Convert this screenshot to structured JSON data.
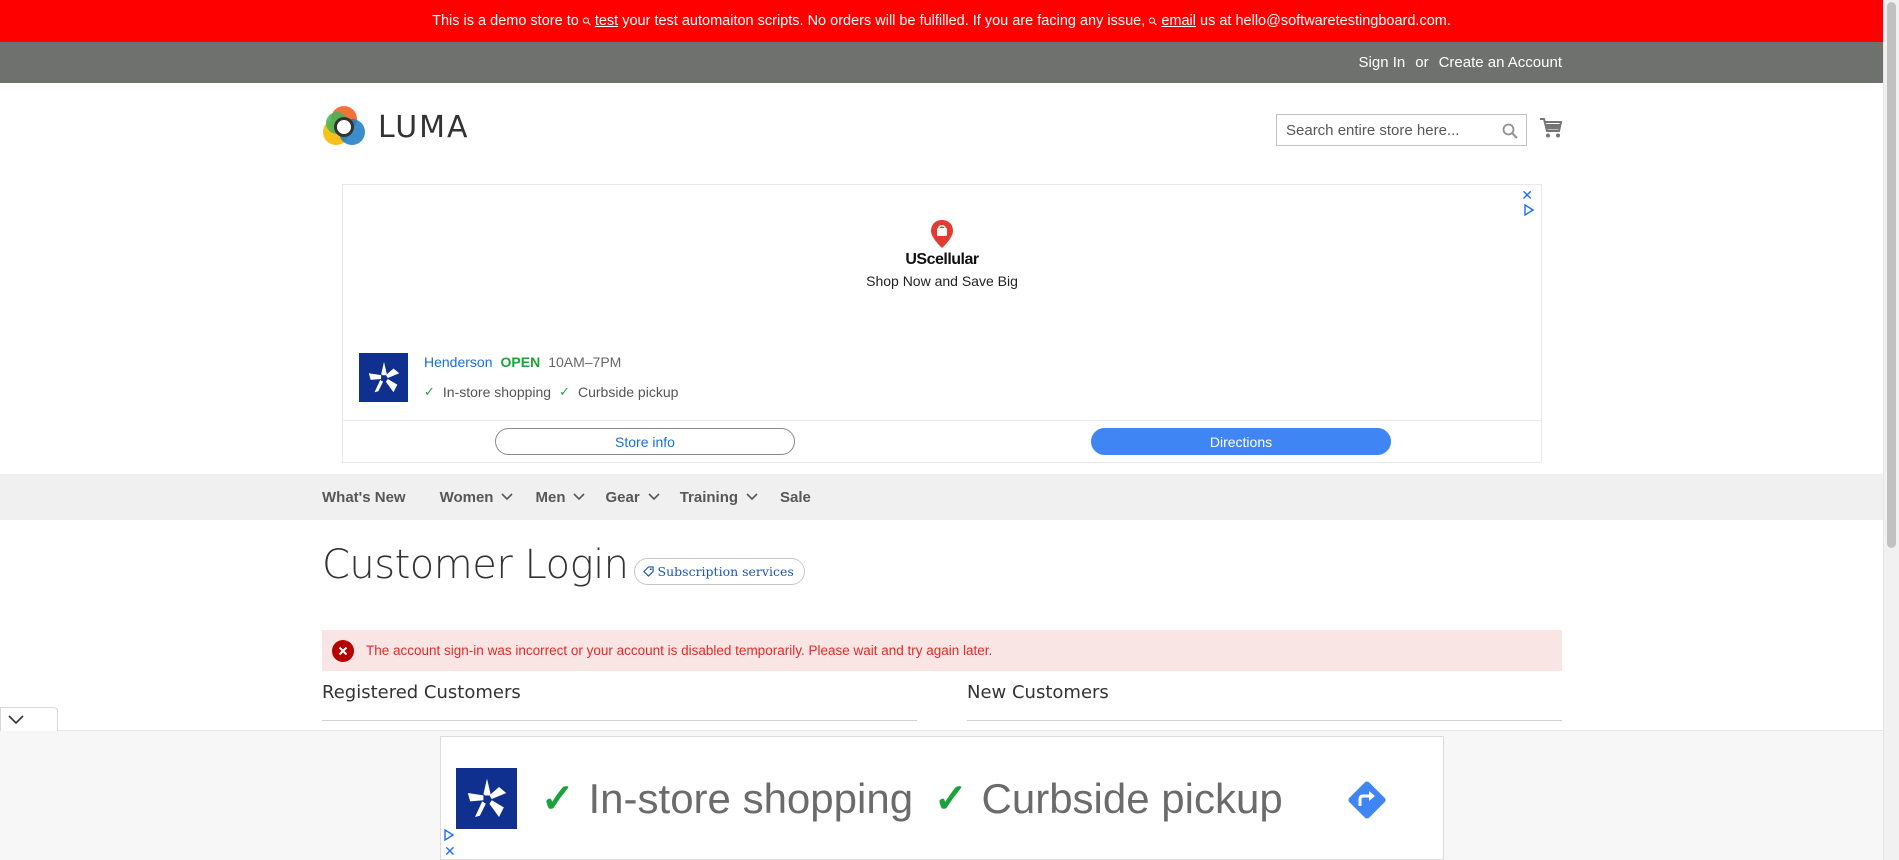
{
  "demo_notice": {
    "part1": "This is a demo store to",
    "link1": "test",
    "part2": "your test automaiton scripts. No orders will be fulfilled. If you are facing any issue,",
    "link2": "email",
    "part3": "us at hello@softwaretestingboard.com."
  },
  "top_links": {
    "sign_in": "Sign In",
    "or": "or",
    "create_account": "Create an Account"
  },
  "header": {
    "logo_text": "LUMA",
    "search_placeholder": "Search entire store here..."
  },
  "ad": {
    "brand": "UScellular",
    "tagline": "Shop Now and Save Big",
    "store_name": "Henderson",
    "store_status": "OPEN",
    "store_hours": "10AM–7PM",
    "feature1": "In-store shopping",
    "feature2": "Curbside pickup",
    "btn_store_info": "Store info",
    "btn_directions": "Directions",
    "close_glyph": "✕",
    "accent_color": "#3f85f4",
    "open_color": "#1aa33a"
  },
  "nav": {
    "items": [
      {
        "label": "What's New",
        "has_dropdown": false
      },
      {
        "label": "Women",
        "has_dropdown": true
      },
      {
        "label": "Men",
        "has_dropdown": true
      },
      {
        "label": "Gear",
        "has_dropdown": true
      },
      {
        "label": "Training",
        "has_dropdown": true
      },
      {
        "label": "Sale",
        "has_dropdown": false
      }
    ]
  },
  "main": {
    "page_title": "Customer Login",
    "subscription_badge": "Subscription services",
    "error_message": "The account sign-in was incorrect or your account is disabled temporarily. Please wait and try again later.",
    "registered_heading": "Registered Customers",
    "new_heading": "New Customers"
  },
  "anchor_ad": {
    "feature1": "In-store shopping",
    "feature2": "Curbside pickup",
    "close_glyph": "✕"
  },
  "colors": {
    "demo_bar": "#ff0000",
    "top_links_bar": "#6e716e",
    "nav_bar": "#f0f0f0",
    "error_bg": "#fae5e5",
    "error_text": "#e02b27"
  }
}
